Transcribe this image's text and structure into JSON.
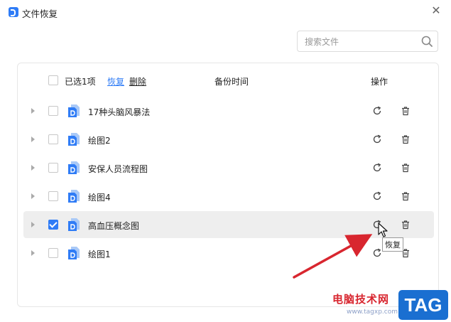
{
  "window": {
    "title": "文件恢复",
    "close_glyph": "✕"
  },
  "search": {
    "placeholder": "搜索文件",
    "value": ""
  },
  "header": {
    "selected_count": "已选1项",
    "restore_label": "恢复",
    "delete_label": "删除",
    "col_backup_time": "备份时间",
    "col_actions": "操作"
  },
  "rows": [
    {
      "name": "17种头脑风暴法",
      "checked": false
    },
    {
      "name": "绘图2",
      "checked": false
    },
    {
      "name": "安保人员流程图",
      "checked": false
    },
    {
      "name": "绘图4",
      "checked": false
    },
    {
      "name": "高血压概念图",
      "checked": true
    },
    {
      "name": "绘图1",
      "checked": false
    }
  ],
  "tooltip": {
    "text": "恢复"
  },
  "icons": {
    "app": "app-logo-icon",
    "search": "search-icon",
    "expand": "chevron-right-icon",
    "file": "document-icon",
    "restore": "refresh-icon",
    "delete": "trash-icon"
  },
  "colors": {
    "accent": "#2f7cf6",
    "annotation": "#d8262f",
    "hover_row": "#eeeeee"
  },
  "watermark": {
    "site_name": "电脑技术网",
    "url": "www.tagxp.com",
    "logo_text": "TAG"
  }
}
